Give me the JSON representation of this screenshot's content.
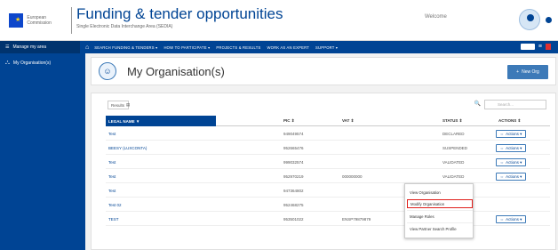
{
  "header": {
    "eu_logo_text": "European Commission",
    "app_title": "Funding & tender opportunities",
    "app_subtitle": "Single Electronic Data Interchange Area (SEDIA)",
    "welcome": "Welcome"
  },
  "nav": {
    "my_area": "Manage my area",
    "items": [
      "SEARCH FUNDING & TENDERS ▾",
      "HOW TO PARTICIPATE ▾",
      "PROJECTS & RESULTS",
      "WORK AS AN EXPERT",
      "SUPPORT ▾"
    ]
  },
  "sidebar": {
    "items": [
      {
        "label": "My Organisation(s)",
        "icon": "org-chart-icon"
      }
    ]
  },
  "page": {
    "title": "My Organisation(s)",
    "new_button": "New Org"
  },
  "table": {
    "results_label": "Results",
    "search_placeholder": "Search...",
    "columns": [
      "LEGAL NAME ▼",
      "PIC ⇕",
      "VAT ⇕",
      "STATUS ⇕",
      "ACTIONS ⇕"
    ],
    "rows": [
      {
        "name": "Test",
        "pic": "949049574",
        "vat": "",
        "status": "DECLARED"
      },
      {
        "name": "BEESY (LUXCONTA)",
        "pic": "952665476",
        "vat": "",
        "status": "SUSPENDED"
      },
      {
        "name": "Test",
        "pic": "999032574",
        "vat": "",
        "status": "VALIDATED"
      },
      {
        "name": "Test",
        "pic": "952970219",
        "vat": "000000000",
        "status": "VALIDATED"
      },
      {
        "name": "Test",
        "pic": "947364802",
        "vat": "",
        "status": "SUSPENDED"
      },
      {
        "name": "Test 02",
        "pic": "952468275",
        "vat": "",
        "status": "SUSPENDED"
      },
      {
        "name": "TEST",
        "pic": "953501022",
        "vat": "ENSP79879879",
        "status": "SUSPENDED"
      }
    ],
    "actions_label": "Actions ▾"
  },
  "dropdown": {
    "items": [
      "View Organisation",
      "Modify Organisation",
      "Manage Roles",
      "View Partner Search Profile"
    ]
  }
}
